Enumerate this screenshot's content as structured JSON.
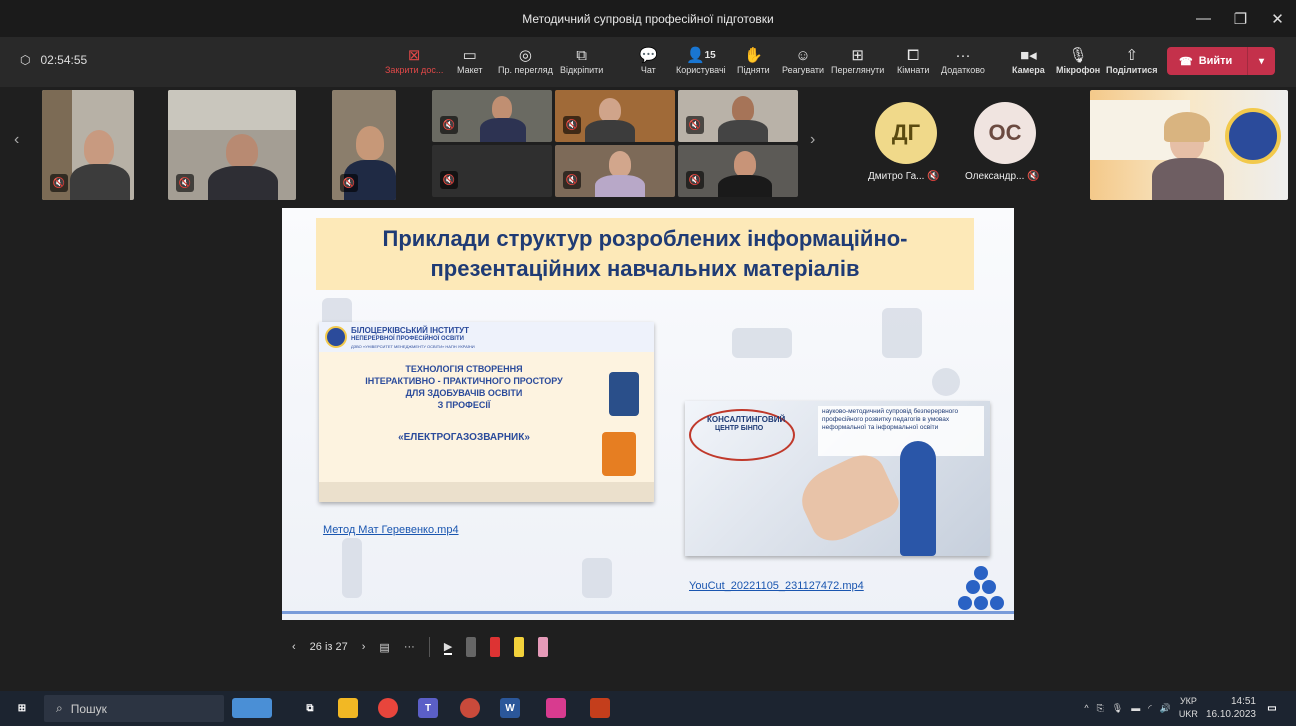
{
  "window": {
    "title": "Методичний супровід професійної підготовки"
  },
  "meeting": {
    "timer": "02:54:55"
  },
  "toolbar": {
    "close_share": "Закрити дос...",
    "layout": "Макет",
    "preview": "Пр. перегляд",
    "popout": "Відкріпити",
    "chat": "Чат",
    "people_count": "15",
    "people": "Користувачі",
    "raise": "Підняти",
    "react": "Реагувати",
    "view": "Переглянути",
    "rooms": "Кімнати",
    "more": "Додатково",
    "camera": "Камера",
    "mic": "Мікрофон",
    "share": "Поділитися",
    "leave": "Вийти"
  },
  "participants": {
    "avatars": [
      {
        "initials": "ДГ",
        "name": "Дмитро Га...",
        "color": "#f0d98a",
        "text_color": "#5a4a10"
      },
      {
        "initials": "ОС",
        "name": "Олександр...",
        "color": "#f0e4e0",
        "text_color": "#6b4a40"
      }
    ]
  },
  "slide": {
    "title_line1": "Приклади структур розроблених інформаційно-",
    "title_line2": "презентаційних навчальних матеріалів",
    "card1": {
      "inst_line1": "БІЛОЦЕРКІВСЬКИЙ ІНСТИТУТ",
      "inst_line2": "НЕПЕРЕРВНОЇ ПРОФЕСІЙНОЇ ОСВІТИ",
      "inst_line3": "ДЗВО «УНІВЕРСИТЕТ МЕНЕДЖМЕНТУ ОСВІТИ» НАПН УКРАЇНИ",
      "line1": "ТЕХНОЛОГІЯ СТВОРЕННЯ",
      "line2": "ІНТЕРАКТИВНО - ПРАКТИЧНОГО ПРОСТОРУ",
      "line3": "ДЛЯ ЗДОБУВАЧІВ ОСВІТИ",
      "line4": "З ПРОФЕСІЇ",
      "profession": "«ЕЛЕКТРОГАЗОЗВАРНИК»"
    },
    "link1": "Метод Мат Геревенко.mp4",
    "card2": {
      "brand_line1": "КОНСАЛТИНГОВИЙ",
      "brand_line2": "ЦЕНТР БІНПО",
      "desc": "науково-методичний супровід безперервного професійного розвитку педагогів в умовах неформальної та інформальної освіти"
    },
    "link2": "YouCut_20221105_231127472.mp4"
  },
  "slide_nav": {
    "page": "26 із 27"
  },
  "taskbar": {
    "search": "Пошук",
    "lang_top": "УКР",
    "lang_bottom": "UKR",
    "time": "14:51",
    "date": "16.10.2023"
  }
}
